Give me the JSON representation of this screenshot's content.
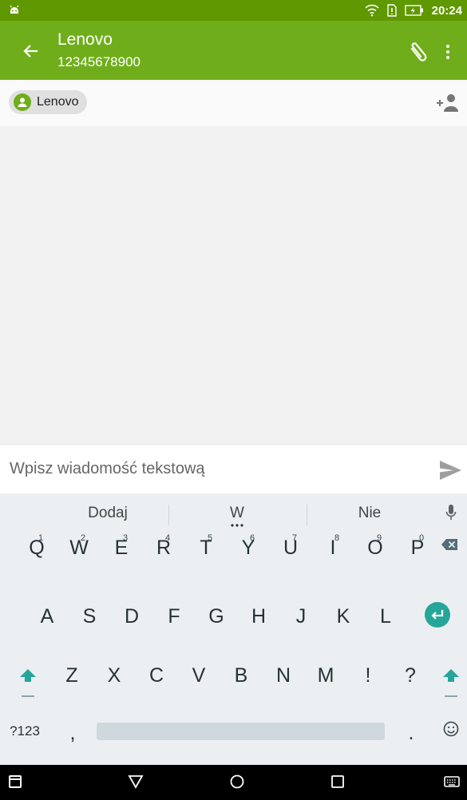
{
  "status_bar": {
    "time": "20:24"
  },
  "app_bar": {
    "contact_name": "Lenovo",
    "phone_number": "12345678900"
  },
  "recipient": {
    "chip_label": "Lenovo"
  },
  "compose": {
    "placeholder": "Wpisz wiadomość tekstową"
  },
  "keyboard": {
    "suggestions": [
      "Dodaj",
      "W",
      "Nie"
    ],
    "row1": [
      {
        "key": "Q",
        "hint": "1"
      },
      {
        "key": "W",
        "hint": "2"
      },
      {
        "key": "E",
        "hint": "3"
      },
      {
        "key": "R",
        "hint": "4"
      },
      {
        "key": "T",
        "hint": "5"
      },
      {
        "key": "Y",
        "hint": "6"
      },
      {
        "key": "U",
        "hint": "7"
      },
      {
        "key": "I",
        "hint": "8"
      },
      {
        "key": "O",
        "hint": "9"
      },
      {
        "key": "P",
        "hint": "0"
      }
    ],
    "row2": [
      "A",
      "S",
      "D",
      "F",
      "G",
      "H",
      "J",
      "K",
      "L"
    ],
    "row3": [
      "Z",
      "X",
      "C",
      "V",
      "B",
      "N",
      "M",
      "!",
      "?"
    ],
    "symbols_key": "?123",
    "comma_key": ",",
    "period_key": "."
  },
  "icons": {
    "status_left": "android-icon",
    "wifi": "wifi-icon",
    "sim": "sim-alert-icon",
    "battery": "battery-charging-icon",
    "back": "arrow-left-icon",
    "attach": "paperclip-icon",
    "more": "more-vert-icon",
    "avatar": "person-icon",
    "add_person": "add-person-icon",
    "send": "send-icon",
    "mic": "mic-icon",
    "backspace": "backspace-icon",
    "enter": "enter-icon",
    "shift": "shift-icon",
    "emoji": "emoji-icon",
    "nav_recent": "recent-apps-icon",
    "nav_back": "nav-back-icon",
    "nav_home": "home-icon",
    "nav_overview": "overview-icon",
    "nav_keyboard": "keyboard-icon"
  },
  "colors": {
    "status_bar": "#5f9800",
    "app_bar": "#6fae1a",
    "accent": "#26a69a"
  }
}
